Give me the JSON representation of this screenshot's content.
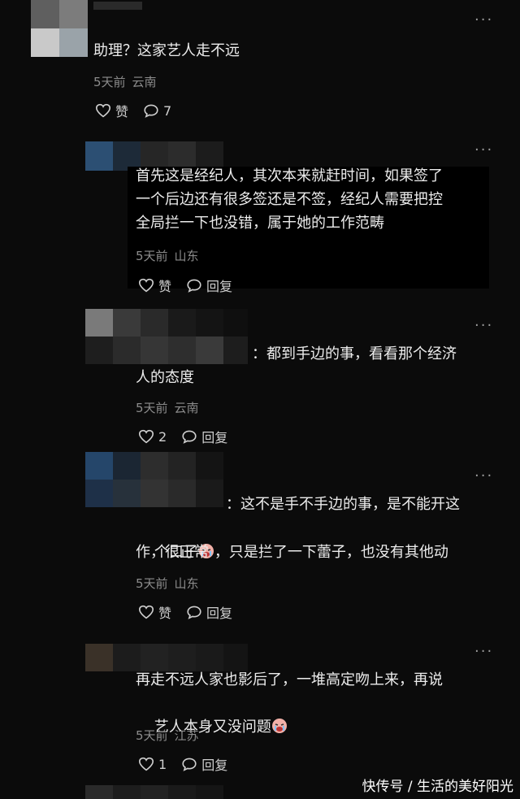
{
  "comments": [
    {
      "text": "助理？这家艺人走不远",
      "time": "5天前",
      "location": "云南",
      "like_label": "赞",
      "reply_label": "7"
    },
    {
      "text": "首先这是经纪人，其次本来就赶时间，如果签了\n一个后边还有很多签还是不签，经纪人需要把控\n全局拦一下也没错，属于她的工作范畴",
      "time": "5天前",
      "location": "山东",
      "like_label": "赞",
      "reply_label": "回复"
    },
    {
      "text": "：都到手边的事，看看那个经济",
      "text2": "人的态度",
      "time": "5天前",
      "location": "云南",
      "like_label": "2",
      "reply_label": "回复"
    },
    {
      "text": "：这不是手不手边的事，是不能开这",
      "text2a": "个口子",
      "text2b": "，只是拦了一下蕾子，也没有其他动",
      "text3": "作，很正常",
      "time": "5天前",
      "location": "山东",
      "like_label": "赞",
      "reply_label": "回复"
    },
    {
      "text": "再走不远人家也影后了，一堆高定吻上来，再说",
      "text2": "艺人本身又没问题",
      "time": "5天前",
      "location": "江苏",
      "like_label": "1",
      "reply_label": "回复"
    }
  ],
  "more_glyph": "···",
  "watermark": "快传号 / 生活的美好阳光",
  "icons": {
    "like": "heart-outline-icon",
    "reply": "speech-bubble-icon",
    "emoji": "crying-face-icon"
  }
}
